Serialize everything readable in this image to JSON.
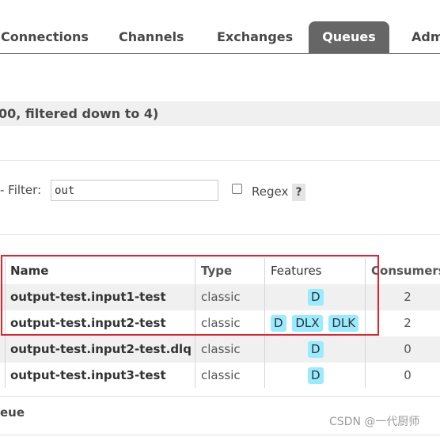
{
  "tabs": [
    {
      "label": "Connections",
      "active": false
    },
    {
      "label": "Channels",
      "active": false
    },
    {
      "label": "Exchanges",
      "active": false
    },
    {
      "label": "Queues",
      "active": true
    },
    {
      "label": "Adm",
      "active": false
    }
  ],
  "title_bar": {
    "text": "00, filtered down to 4)"
  },
  "filter": {
    "label": "- Filter:",
    "value": "out",
    "regex_label": "Regex",
    "regex_checked": false,
    "help_label": "?"
  },
  "table": {
    "columns": [
      "Name",
      "Type",
      "Features",
      "Consumers"
    ],
    "rows": [
      {
        "name": "output-test.input1-test",
        "type": "classic",
        "features": [
          "D"
        ],
        "consumers": "2"
      },
      {
        "name": "output-test.input2-test",
        "type": "classic",
        "features": [
          "D",
          "DLX",
          "DLK"
        ],
        "consumers": "2"
      },
      {
        "name": "output-test.input2-test.dlq",
        "type": "classic",
        "features": [
          "D"
        ],
        "consumers": "0"
      },
      {
        "name": "output-test.input3-test",
        "type": "classic",
        "features": [
          "D"
        ],
        "consumers": "0"
      }
    ]
  },
  "bottom": {
    "text": "eue"
  },
  "watermark": {
    "text": "CSDN @一代厨师"
  },
  "colors": {
    "active_tab_bg": "#666666",
    "badge_bg": "#99ebff",
    "highlight_border": "#e8202a"
  }
}
